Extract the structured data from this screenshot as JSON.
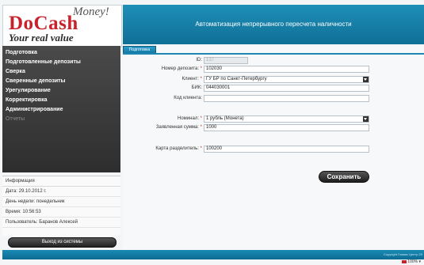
{
  "logo": {
    "main": "DoCash",
    "money": "Money!",
    "tagline": "Your real value"
  },
  "header": {
    "title": "Автоматизация непрерывного пересчета наличности"
  },
  "sidebar": {
    "items": [
      {
        "label": "Подготовка"
      },
      {
        "label": "Подготовленные депозиты"
      },
      {
        "label": "Сверка"
      },
      {
        "label": "Сверенные депозиты"
      },
      {
        "label": "Урегулирование"
      },
      {
        "label": "Корректировка"
      },
      {
        "label": "Администрирование"
      },
      {
        "label": "Отчеты"
      }
    ]
  },
  "info": {
    "heading": "Информация",
    "date": "Дата: 29.10.2012 г.",
    "weekday": "День недели: понедельник",
    "time": "Время: 10:56:53",
    "user": "Пользователь: Баранов Алексей"
  },
  "logout_label": "Выход из системы",
  "tab": {
    "label": "Подготовка"
  },
  "form": {
    "id_label": "ID:",
    "id_value": "137",
    "deposit_number_label": "Номер депозита:",
    "deposit_number_value": "102030",
    "client_label": "Клиент:",
    "client_value": "ГУ БР по Санкт-Петербургу",
    "bik_label": "БИК:",
    "bik_value": "044030001",
    "client_code_label": "Код клиента:",
    "client_code_value": "",
    "denomination_label": "Номинал:",
    "denomination_value": "1 рубль (Монета)",
    "declared_sum_label": "Заявленная сумма:",
    "declared_sum_value": "1000",
    "separator_card_label": "Карта разделитель:",
    "separator_card_value": "100200",
    "required_mark": "*"
  },
  "save_label": "Сохранить",
  "footer": {
    "copyright": "Copyright Главис Центр 20"
  },
  "zoom": "100%"
}
